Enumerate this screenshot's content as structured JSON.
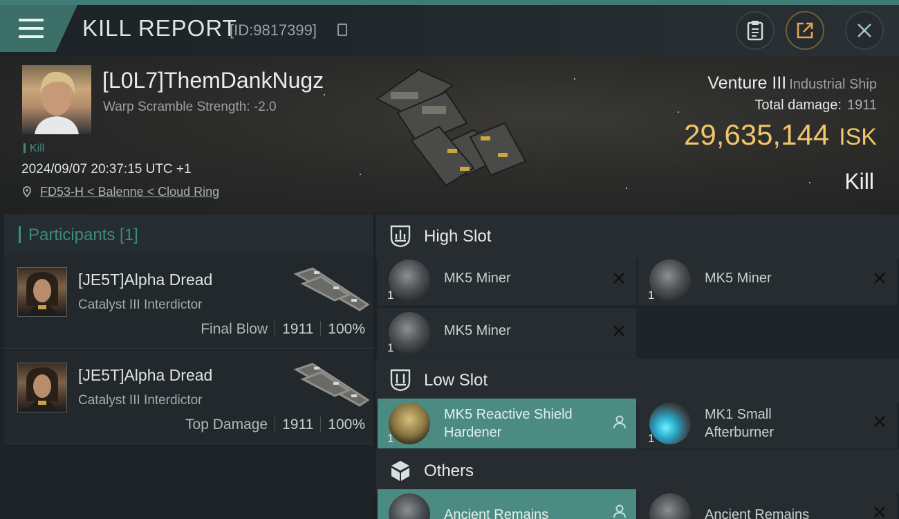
{
  "header": {
    "title": "KILL REPORT",
    "report_id": "[ID:9817399]",
    "buttons": [
      "clipboard-icon",
      "share-icon",
      "close-icon"
    ]
  },
  "victim": {
    "pilot_name": "[L0L7]ThemDankNugz",
    "warp_scramble": "Warp Scramble Strength: -2.0",
    "tag": "Kill",
    "datetime": "2024/09/07 20:37:15 UTC +1",
    "location": "FD53-H < Balenne < Cloud Ring",
    "ship_name": "Venture III",
    "ship_class": "Industrial Ship",
    "total_damage_label": "Total damage:",
    "total_damage": "1911",
    "isk_value": "29,635,144",
    "isk_unit": "ISK",
    "outcome": "Kill"
  },
  "participants": {
    "title": "Participants [1]",
    "rows": [
      {
        "name": "[JE5T]Alpha Dread",
        "ship": "Catalyst III Interdictor",
        "label": "Final Blow",
        "damage": "1911",
        "percent": "100%"
      },
      {
        "name": "[JE5T]Alpha Dread",
        "ship": "Catalyst III Interdictor",
        "label": "Top Damage",
        "damage": "1911",
        "percent": "100%"
      }
    ]
  },
  "fitting": {
    "high_slot": {
      "title": "High Slot",
      "items": [
        {
          "name": "MK5 Miner",
          "qty": "1"
        },
        {
          "name": "MK5 Miner",
          "qty": "1"
        },
        {
          "name": "MK5 Miner",
          "qty": "1"
        }
      ]
    },
    "low_slot": {
      "title": "Low Slot",
      "items": [
        {
          "name": "MK5 Reactive Shield Hardener",
          "qty": "1"
        },
        {
          "name": "MK1 Small Afterburner",
          "qty": "1"
        }
      ]
    },
    "others": {
      "title": "Others",
      "items": [
        {
          "name": "Ancient Remains"
        },
        {
          "name": "Ancient Remains"
        }
      ]
    }
  },
  "colors": {
    "accent_teal": "#3f7c75",
    "isk_gold": "#f1c66a",
    "highlight_item": "#4b8b82"
  }
}
